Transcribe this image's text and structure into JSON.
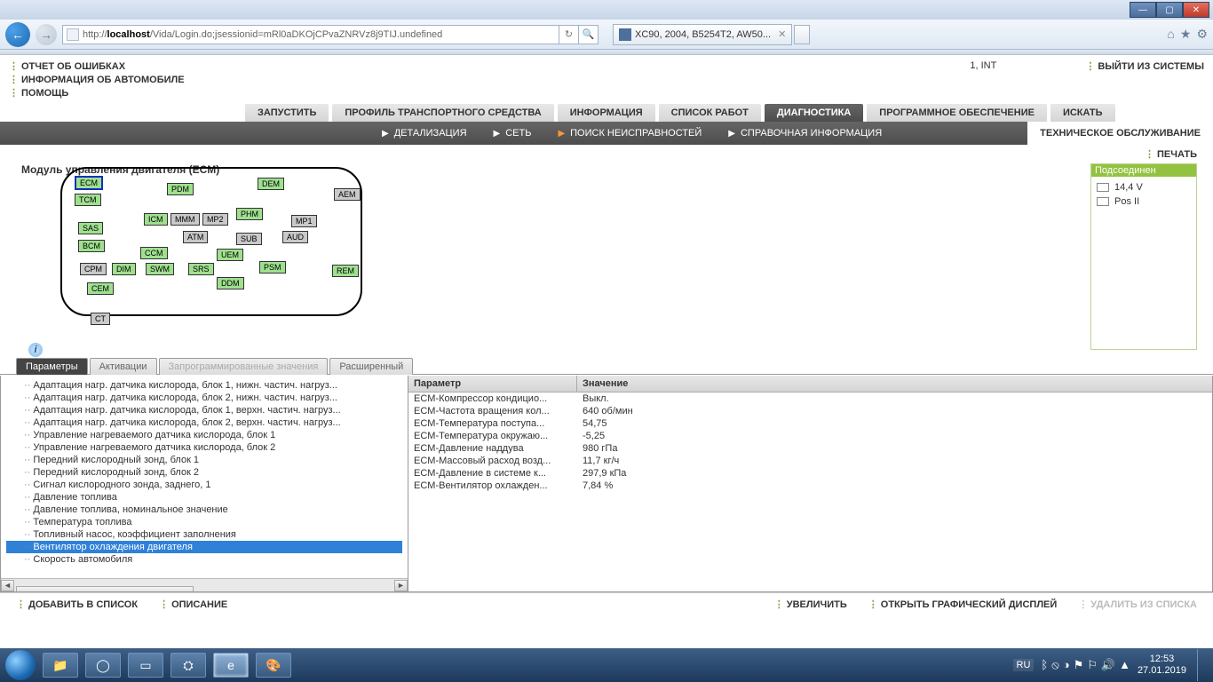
{
  "browser": {
    "url_prefix": "http://",
    "url_host": "localhost",
    "url_path": "/Vida/Login.do;jsessionid=mRl0aDKOjCPvaZNRVz8j9TIJ.undefined",
    "tab_title": "XC90, 2004, B5254T2, AW50..."
  },
  "top_links": {
    "l1": "ОТЧЕТ ОБ ОШИБКАХ",
    "l2": "ИНФОРМАЦИЯ ОБ АВТОМОБИЛЕ",
    "l3": "ПОМОЩЬ",
    "int": "1, INT",
    "exit": "ВЫЙТИ ИЗ СИСТЕМЫ"
  },
  "main_tabs": {
    "t1": "ЗАПУСТИТЬ",
    "t2": "ПРОФИЛЬ ТРАНСПОРТНОГО СРЕДСТВА",
    "t3": "ИНФОРМАЦИЯ",
    "t4": "СПИСОК РАБОТ",
    "t5": "ДИАГНОСТИКА",
    "t6": "ПРОГРАММНОЕ ОБЕСПЕЧЕНИЕ",
    "t7": "ИСКАТЬ"
  },
  "sub_items": {
    "s1": "ДЕТАЛИЗАЦИЯ",
    "s2": "СЕТЬ",
    "s3": "ПОИСК НЕИСПРАВНОСТЕЙ",
    "s4": "СПРАВОЧНАЯ ИНФОРМАЦИЯ",
    "s5": "ТЕХНИЧЕСКОЕ ОБСЛУЖИВАНИЕ"
  },
  "print": "ПЕЧАТЬ",
  "diagram_title": "Модуль управления двигателя (ECM)",
  "status": {
    "head": "Подсоединен",
    "voltage": "14,4 V",
    "pos": "Pos II"
  },
  "nodes": {
    "ecm": "ECM",
    "tcm": "TCM",
    "pdm": "PDM",
    "dem": "DEM",
    "aem": "AEM",
    "sas": "SAS",
    "bcm": "BCM",
    "icm": "ICM",
    "mmm": "MMM",
    "mp2": "MP2",
    "phm": "PHM",
    "mp1": "MP1",
    "atm": "ATM",
    "sub": "SUB",
    "aud": "AUD",
    "ccm": "CCM",
    "uem": "UEM",
    "cpm": "CPM",
    "dim": "DIM",
    "swm": "SWM",
    "srs": "SRS",
    "psm": "PSM",
    "rem": "REM",
    "cem": "CEM",
    "ddm": "DDM",
    "ct": "CT"
  },
  "lower_tabs": {
    "t1": "Параметры",
    "t2": "Активации",
    "t3": "Запрограммированные значения",
    "t4": "Расширенный"
  },
  "tree": [
    "Адаптация нагр. датчика кислорода, блок 1, нижн. частич. нагруз...",
    "Адаптация нагр. датчика кислорода, блок 2, нижн. частич. нагруз...",
    "Адаптация нагр. датчика кислорода, блок 1, верхн. частич. нагруз...",
    "Адаптация нагр. датчика кислорода, блок 2, верхн. частич. нагруз...",
    "Управление нагреваемого датчика кислорода, блок 1",
    "Управление нагреваемого датчика кислорода, блок 2",
    "Передний кислородный зонд, блок 1",
    "Передний кислородный зонд, блок 2",
    "Сигнал кислородного зонда, заднего, 1",
    "Давление топлива",
    "Давление топлива, номинальное значение",
    "Температура топлива",
    "Топливный насос, коэффициент заполнения",
    "Вентилятор охлаждения двигателя",
    "Скорость автомобиля"
  ],
  "tree_selected_index": 13,
  "value_headers": {
    "p": "Параметр",
    "v": "Значение"
  },
  "values": [
    {
      "p": "ECM-Компрессор кондицио...",
      "v": "Выкл."
    },
    {
      "p": "ECM-Частота вращения кол...",
      "v": "640 об/мин"
    },
    {
      "p": "ECM-Температура поступа...",
      "v": "54,75"
    },
    {
      "p": "ECM-Температура окружаю...",
      "v": "-5,25"
    },
    {
      "p": "ECM-Давление наддува",
      "v": "980 гПа"
    },
    {
      "p": "ECM-Массовый расход возд...",
      "v": "11,7 кг/ч"
    },
    {
      "p": "ECM-Давление в системе к...",
      "v": "297,9 кПа"
    },
    {
      "p": "ECM-Вентилятор охлажден...",
      "v": "7,84 %"
    }
  ],
  "bottom": {
    "add": "ДОБАВИТЬ В СПИСОК",
    "desc": "ОПИСАНИЕ",
    "zoom": "УВЕЛИЧИТЬ",
    "graphic": "ОТКРЫТЬ ГРАФИЧЕСКИЙ ДИСПЛЕЙ",
    "remove": "УДАЛИТЬ ИЗ СПИСКА"
  },
  "tray": {
    "lang": "RU",
    "time": "12:53",
    "date": "27.01.2019"
  }
}
